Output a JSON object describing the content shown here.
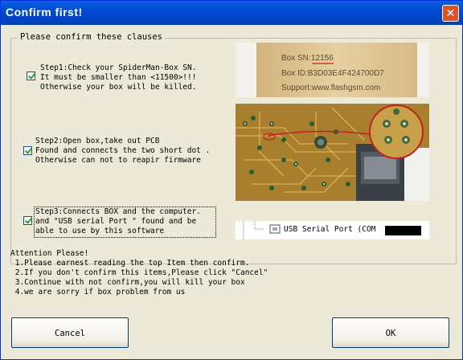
{
  "window": {
    "title": "Confirm first!",
    "close_glyph": "✕"
  },
  "group": {
    "legend": "Please confirm these clauses"
  },
  "steps": [
    {
      "text": "Step1:Check your SpiderMan-Box SN.\nIt must be smaller than <11500>!!!\nOtherwise your box will be killed.",
      "checked": true
    },
    {
      "text": "Step2:Open box,take out PCB\nFound and connects the two short dot .\nOtherwise can not to reapir firmware",
      "checked": true
    },
    {
      "text": "Step3:Connects BOX and the computer.\nand \"USB serial Port \" found and be\nable to use by this software",
      "checked": true
    }
  ],
  "label_photo": {
    "line1_prefix": "Box SN:",
    "serial": "12156",
    "line2": "Box ID:B3D03E4F424700D7",
    "line3": "Support:www.flashgsm.com"
  },
  "device_tree": {
    "item_label": "USB Serial Port (COM",
    "icon": "usb-port-icon"
  },
  "attention": {
    "title": "Attention Please!",
    "lines": [
      " 1.Please earnest reading the top Item then confirm.",
      " 2.If you don't confirm this items,Please click \"Cancel\"",
      " 3.Continue with not confirm,you will kill your box",
      " 4.we are sorry if box problem from us"
    ]
  },
  "buttons": {
    "cancel": "Cancel",
    "ok": "OK"
  },
  "colors": {
    "titlebar": "#0450d8",
    "dialog_bg": "#ece9d8",
    "close_button": "#d9532f",
    "pcb": "#b58a2e"
  }
}
